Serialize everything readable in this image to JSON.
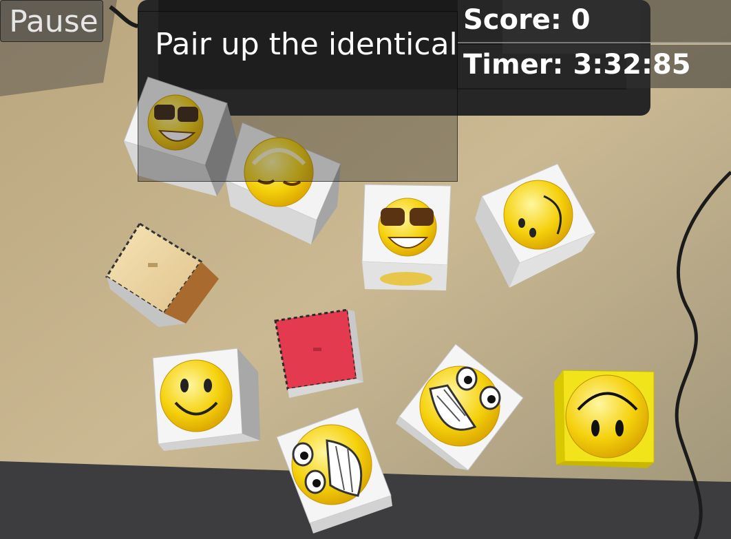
{
  "hud": {
    "pause_label": "Pause",
    "instruction": "Pair up the identical",
    "score_text": "Score: 0",
    "timer_text": "Timer: 3:32:85"
  },
  "colors": {
    "emoji_yellow": "#f5d10c",
    "cube_white": "#f4f4f4",
    "cube_yellow": "#f2e41a",
    "plain_red": "#e33a4f",
    "plain_tan": "#f0d7a3",
    "desk": "#c5b18a"
  },
  "cubes": [
    {
      "id": "cube-1",
      "face": "sunglasses-emoji-icon"
    },
    {
      "id": "cube-2",
      "face": "sleepy-emoji-icon"
    },
    {
      "id": "cube-3",
      "face": "sunglasses-emoji-icon"
    },
    {
      "id": "cube-4",
      "face": "smile-emoji-icon"
    },
    {
      "id": "cube-5",
      "face": "plain-tan-marker-icon"
    },
    {
      "id": "cube-6",
      "face": "plain-red-marker-icon"
    },
    {
      "id": "cube-7",
      "face": "smile-emoji-icon"
    },
    {
      "id": "cube-8",
      "face": "grin-teeth-emoji-icon"
    },
    {
      "id": "cube-9",
      "face": "grin-teeth-emoji-icon"
    },
    {
      "id": "cube-10",
      "face": "smile-emoji-icon"
    }
  ]
}
